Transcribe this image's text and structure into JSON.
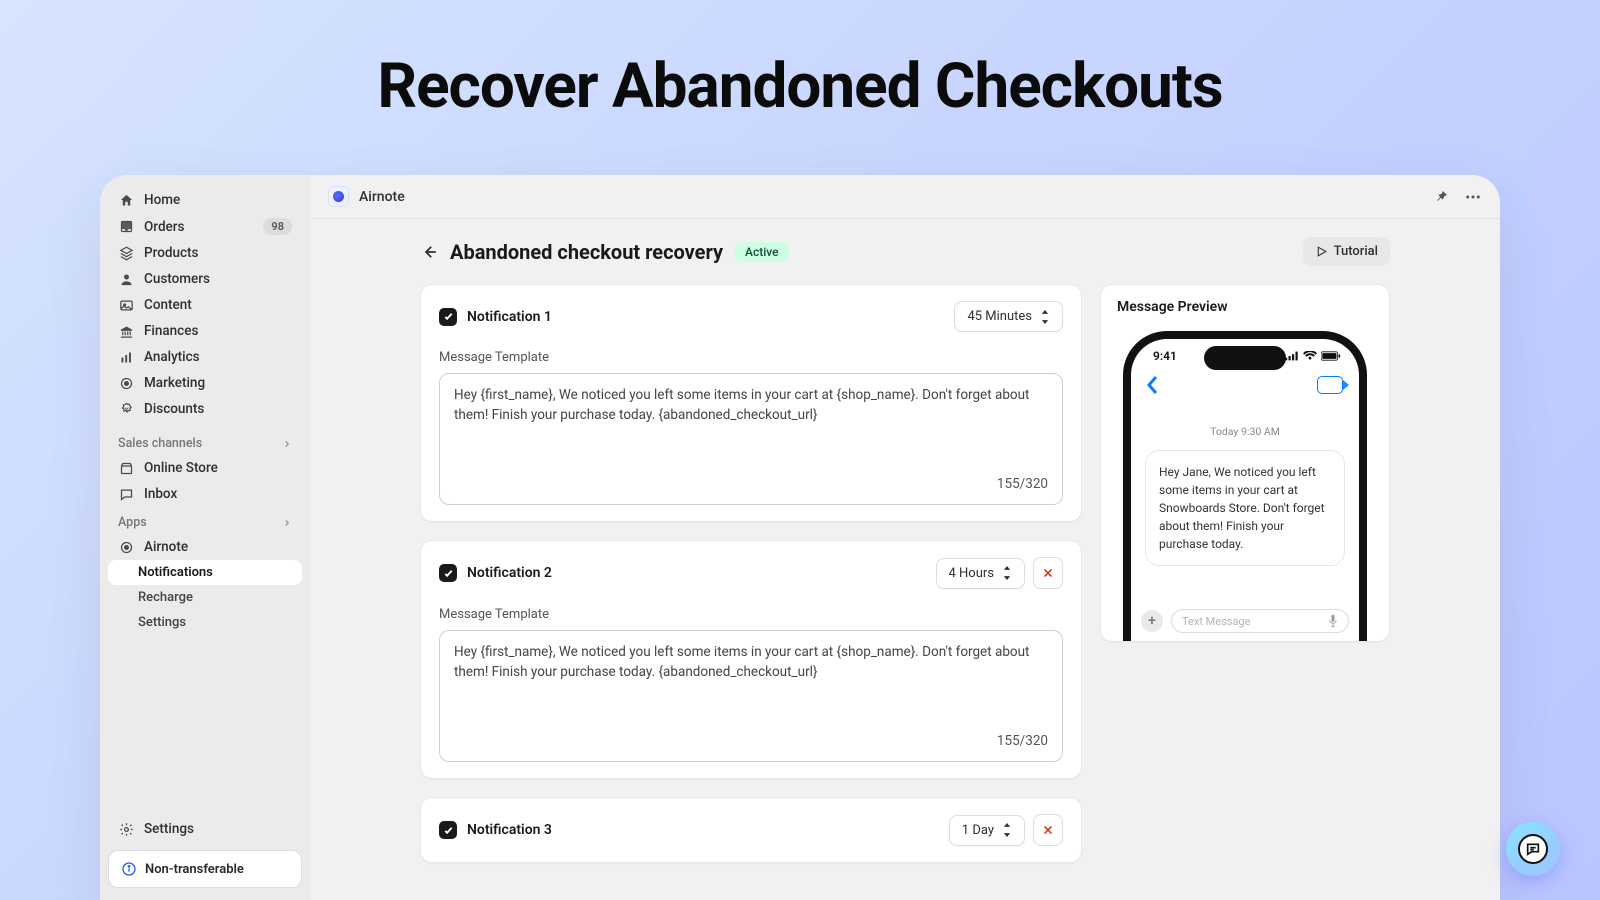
{
  "hero": {
    "title": "Recover Abandoned Checkouts"
  },
  "topbar": {
    "app_name": "Airnote"
  },
  "sidebar": {
    "items": [
      {
        "label": "Home"
      },
      {
        "label": "Orders",
        "badge": "98"
      },
      {
        "label": "Products"
      },
      {
        "label": "Customers"
      },
      {
        "label": "Content"
      },
      {
        "label": "Finances"
      },
      {
        "label": "Analytics"
      },
      {
        "label": "Marketing"
      },
      {
        "label": "Discounts"
      }
    ],
    "channels_header": "Sales channels",
    "channels": [
      {
        "label": "Online Store"
      },
      {
        "label": "Inbox"
      }
    ],
    "apps_header": "Apps",
    "apps": [
      {
        "label": "Airnote"
      }
    ],
    "app_subitems": [
      {
        "label": "Notifications"
      },
      {
        "label": "Recharge"
      },
      {
        "label": "Settings"
      }
    ],
    "settings_label": "Settings",
    "non_transferable_label": "Non-transferable"
  },
  "page": {
    "title": "Abandoned checkout recovery",
    "status": "Active",
    "tutorial_label": "Tutorial"
  },
  "notifications": [
    {
      "title": "Notification 1",
      "delay": "45 Minutes",
      "removable": false,
      "field_label": "Message Template",
      "template": "Hey {first_name}, We noticed you left some items in your cart at {shop_name}. Don't forget about them! Finish your purchase today. {abandoned_checkout_url}",
      "char_count": "155/320"
    },
    {
      "title": "Notification 2",
      "delay": "4 Hours",
      "removable": true,
      "field_label": "Message Template",
      "template": "Hey {first_name}, We noticed you left some items in your cart at {shop_name}. Don't forget about them! Finish your purchase today. {abandoned_checkout_url}",
      "char_count": "155/320"
    },
    {
      "title": "Notification 3",
      "delay": "1 Day",
      "removable": true
    }
  ],
  "preview": {
    "title": "Message Preview",
    "time": "9:41",
    "timestamp": "Today 9:30 AM",
    "bubble": "Hey Jane, We noticed you left some items in your cart at Snowboards Store. Don't forget about them! Finish your purchase today.",
    "compose_placeholder": "Text Message"
  }
}
